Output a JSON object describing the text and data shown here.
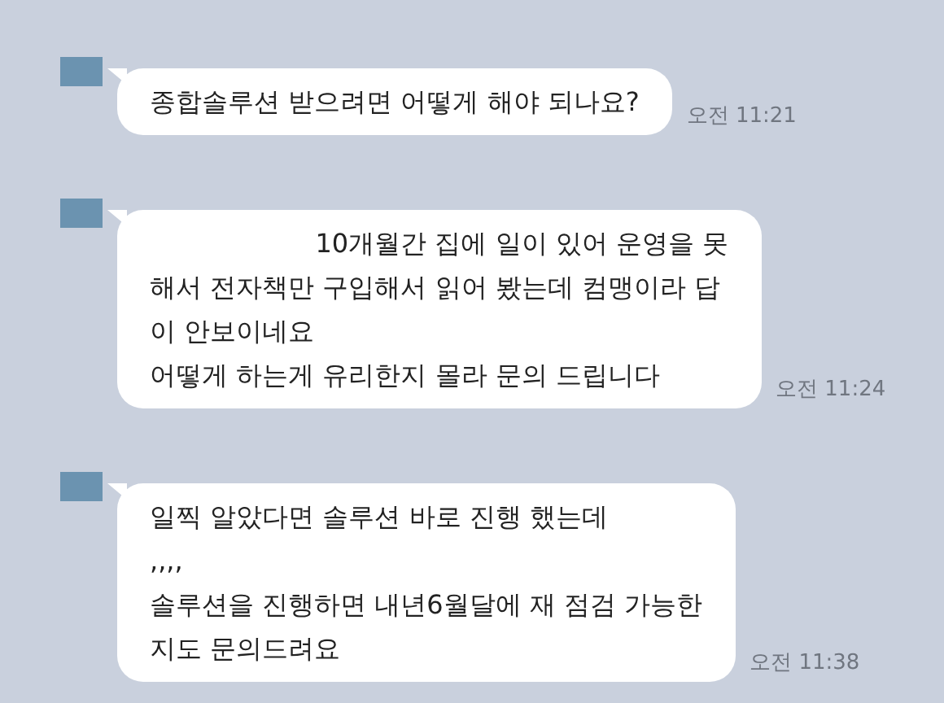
{
  "messages": [
    {
      "lines": [
        "종합솔루션 받으려면 어떻게 해야 되나요?"
      ],
      "time": "오전 11:21"
    },
    {
      "lines": [
        "                    10개월간 집에 일이 있어 운영을 못",
        "해서 전자책만 구입해서 읽어 봤는데 컴맹이라 답",
        "이 안보이네요",
        "어떻게 하는게 유리한지 몰라 문의 드립니다"
      ],
      "time": "오전 11:24"
    },
    {
      "lines": [
        "일찍 알았다면 솔루션 바로 진행 했는데",
        ",,,,",
        "솔루션을 진행하면 내년6월달에 재 점검 가능한",
        "지도 문의드려요"
      ],
      "time": "오전 11:38"
    }
  ]
}
